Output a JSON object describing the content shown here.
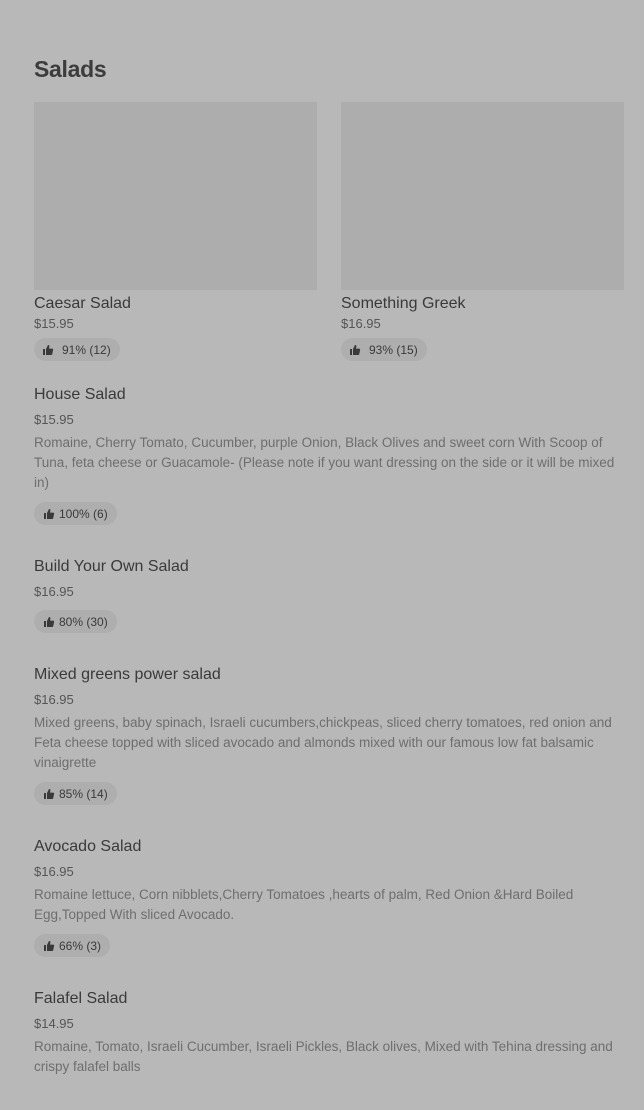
{
  "section": {
    "title": "Salads"
  },
  "featured": [
    {
      "name": "Caesar Salad",
      "price": "$15.95",
      "rating": "91% (12)"
    },
    {
      "name": "Something Greek",
      "price": "$16.95",
      "rating": "93% (15)"
    }
  ],
  "items": [
    {
      "name": "House Salad",
      "price": "$15.95",
      "description": "Romaine, Cherry Tomato, Cucumber, purple Onion, Black Olives and sweet corn With Scoop of Tuna, feta cheese or Guacamole- (Please note if you want dressing on the side or it will be mixed in)",
      "rating": "100% (6)"
    },
    {
      "name": "Build Your Own Salad",
      "price": "$16.95",
      "description": "",
      "rating": "80% (30)"
    },
    {
      "name": "Mixed greens power salad",
      "price": "$16.95",
      "description": "Mixed greens, baby spinach, Israeli cucumbers,chickpeas, sliced cherry tomatoes, red onion and Feta cheese topped with sliced avocado and almonds mixed with our famous low fat balsamic vinaigrette",
      "rating": "85% (14)"
    },
    {
      "name": "Avocado Salad",
      "price": "$16.95",
      "description": "Romaine lettuce, Corn nibblets,Cherry Tomatoes ,hearts of palm, Red Onion &Hard Boiled Egg,Topped With sliced Avocado.",
      "rating": "66% (3)"
    },
    {
      "name": "Falafel Salad",
      "price": "$14.95",
      "description": "Romaine, Tomato, Israeli Cucumber, Israeli Pickles, Black olives, Mixed with Tehina dressing and crispy falafel balls",
      "rating": ""
    }
  ],
  "icons": {
    "rating": "thumbs-up-icon"
  },
  "colors": {
    "background": "#b8b8b8",
    "image_placeholder": "#adadad",
    "badge": "#aeaeae"
  }
}
